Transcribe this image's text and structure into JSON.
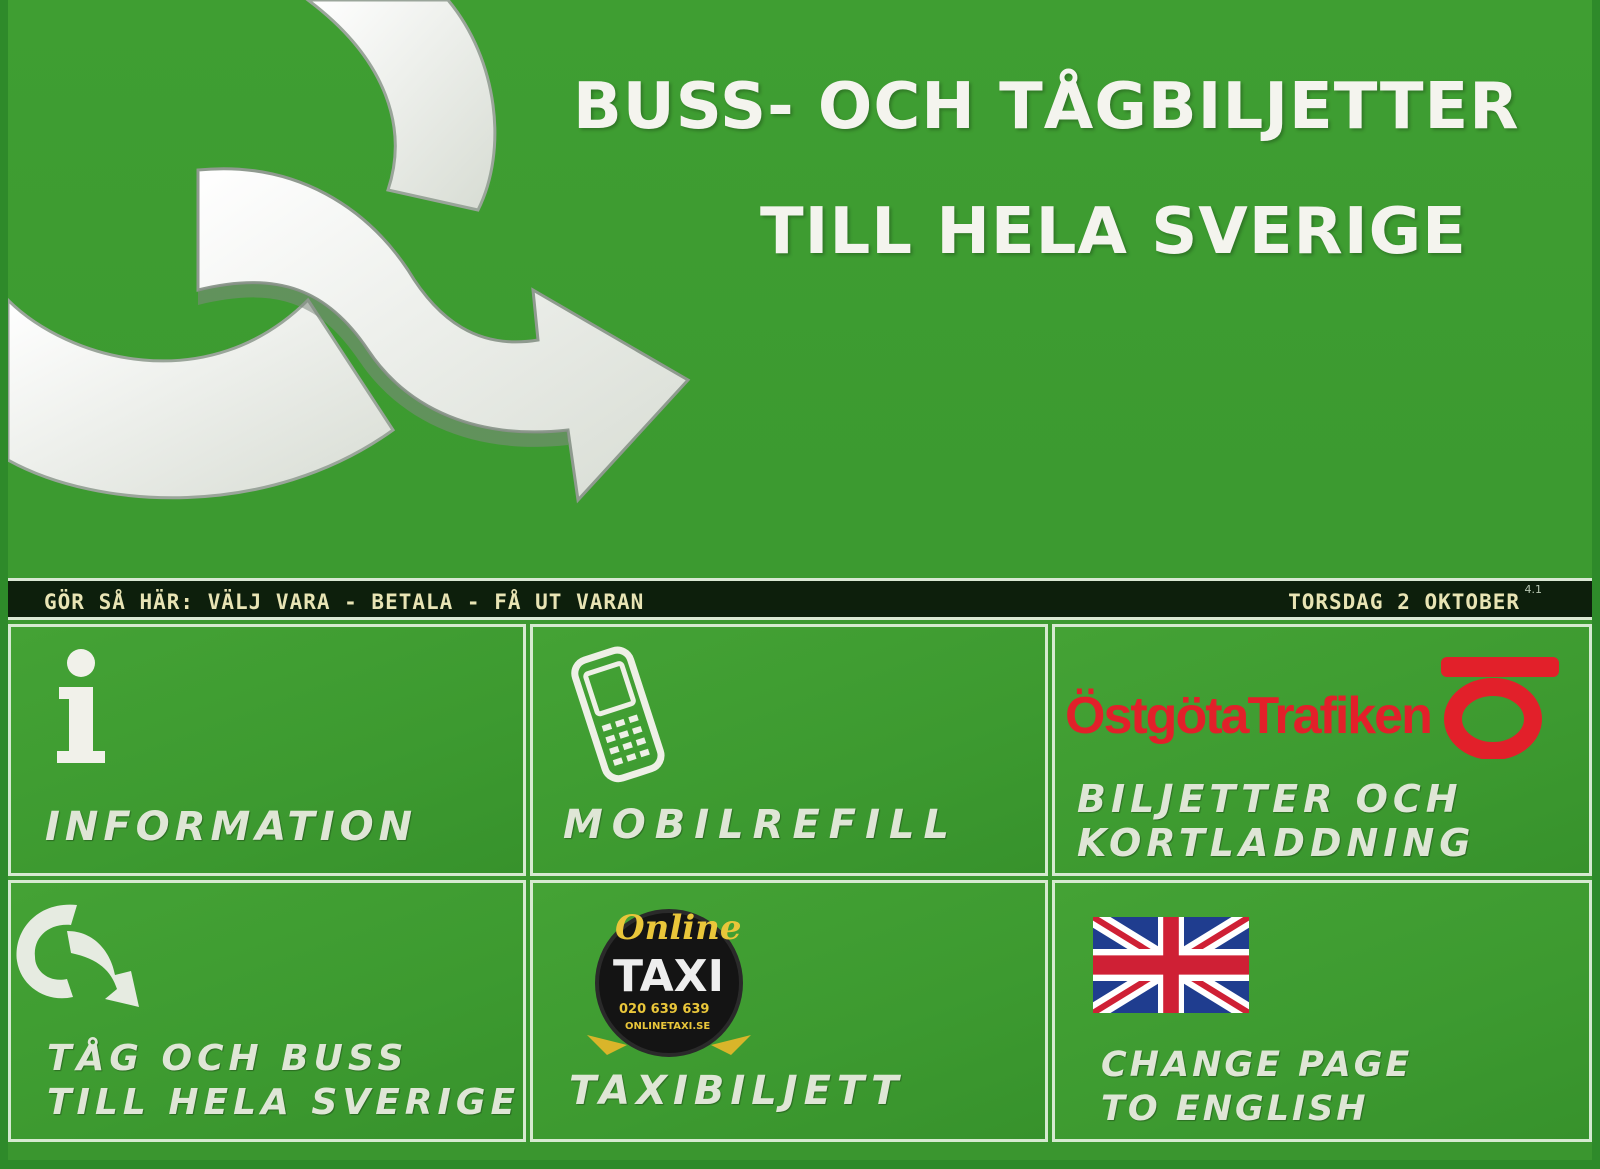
{
  "hero": {
    "headline_line1": "BUSS- OCH TÅGBILJETTER",
    "headline_line2": "TILL HELA SVERIGE"
  },
  "status_bar": {
    "instructions": "GÖR SÅ HÄR: VÄLJ VARA - BETALA - FÅ UT VARAN",
    "date": "TORSDAG 2 OKTOBER",
    "version": "4.1"
  },
  "tiles": [
    {
      "label": "INFORMATION",
      "icon": "info-icon"
    },
    {
      "label": "MOBILREFILL",
      "icon": "mobile-phone-icon"
    },
    {
      "label_line1": "BILJETTER OCH",
      "label_line2": "KORTLADDNING",
      "logo_text": "ÖstgötaTrafiken",
      "icon": "ostgotatrafiken-logo"
    },
    {
      "label_line1": "TÅG OCH BUSS",
      "label_line2": "TILL HELA SVERIGE",
      "icon": "arrow-loop-icon"
    },
    {
      "label": "TAXIBILJETT",
      "icon": "online-taxi-logo",
      "logo_text_1": "Online",
      "logo_text_2": "TAXI",
      "logo_phone": "020 639 639",
      "logo_url": "ONLINETAXI.SE"
    },
    {
      "label_line1": "CHANGE PAGE",
      "label_line2": "TO ENGLISH",
      "icon": "uk-flag-icon"
    }
  ],
  "colors": {
    "screen_green": "#3c9a30",
    "status_bar": "#0d1f0c",
    "status_text": "#e8e4b4",
    "logo_red": "#e2202a"
  }
}
